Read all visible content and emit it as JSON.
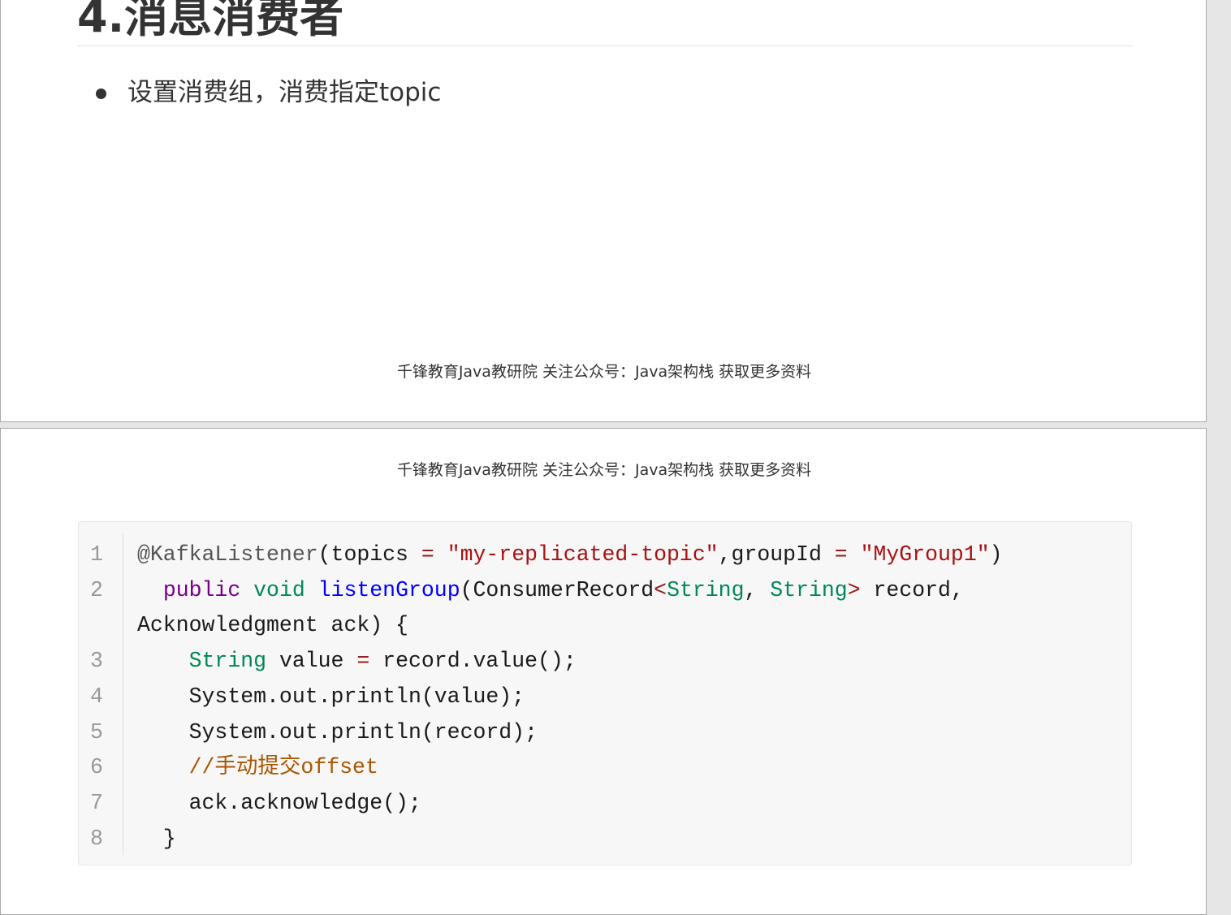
{
  "page1": {
    "heading": "4.消息消费者",
    "bullets": [
      "设置消费组，消费指定topic"
    ],
    "footer": "千锋教育Java教研院 关注公众号：Java架构栈 获取更多资料"
  },
  "page2": {
    "header": "千锋教育Java教研院 关注公众号：Java架构栈 获取更多资料"
  },
  "code": {
    "line_numbers": [
      "1",
      "2",
      "3",
      "4",
      "5",
      "6",
      "7",
      "8"
    ],
    "lines": [
      [
        {
          "t": "meta",
          "s": "@KafkaListener"
        },
        {
          "t": "plain",
          "s": "(topics "
        },
        {
          "t": "op",
          "s": "="
        },
        {
          "t": "plain",
          "s": " "
        },
        {
          "t": "string",
          "s": "\"my-replicated-topic\""
        },
        {
          "t": "plain",
          "s": ",groupId "
        },
        {
          "t": "op",
          "s": "="
        },
        {
          "t": "plain",
          "s": " "
        },
        {
          "t": "string",
          "s": "\"MyGroup1\""
        },
        {
          "t": "plain",
          "s": ")"
        }
      ],
      [
        {
          "t": "plain",
          "s": "  "
        },
        {
          "t": "keyword",
          "s": "public"
        },
        {
          "t": "plain",
          "s": " "
        },
        {
          "t": "type",
          "s": "void"
        },
        {
          "t": "plain",
          "s": " "
        },
        {
          "t": "def",
          "s": "listenGroup"
        },
        {
          "t": "plain",
          "s": "(ConsumerRecord"
        },
        {
          "t": "op",
          "s": "<"
        },
        {
          "t": "type",
          "s": "String"
        },
        {
          "t": "plain",
          "s": ", "
        },
        {
          "t": "type",
          "s": "String"
        },
        {
          "t": "op",
          "s": ">"
        },
        {
          "t": "plain",
          "s": " record,"
        }
      ],
      [
        {
          "t": "plain",
          "s": "Acknowledgment ack) {"
        }
      ],
      [
        {
          "t": "plain",
          "s": "    "
        },
        {
          "t": "type",
          "s": "String"
        },
        {
          "t": "plain",
          "s": " value "
        },
        {
          "t": "op",
          "s": "="
        },
        {
          "t": "plain",
          "s": " record.value();"
        }
      ],
      [
        {
          "t": "plain",
          "s": "    System.out.println(value);"
        }
      ],
      [
        {
          "t": "plain",
          "s": "    System.out.println(record);"
        }
      ],
      [
        {
          "t": "plain",
          "s": "    "
        },
        {
          "t": "comment",
          "s": "//手动提交offset"
        }
      ],
      [
        {
          "t": "plain",
          "s": "    ack.acknowledge();"
        }
      ],
      [
        {
          "t": "plain",
          "s": "  }"
        }
      ]
    ]
  }
}
